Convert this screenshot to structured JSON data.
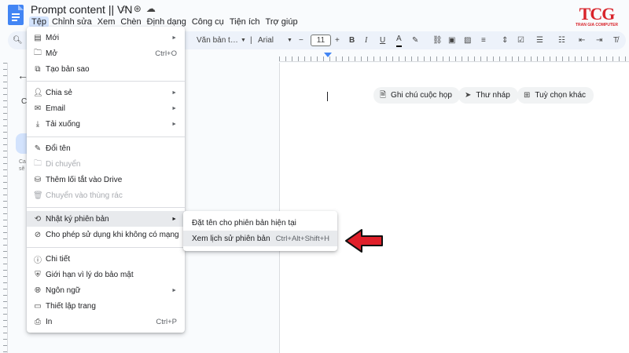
{
  "header": {
    "title": "Prompt content || VN",
    "menu": [
      "Tệp",
      "Chỉnh sửa",
      "Xem",
      "Chèn",
      "Định dạng",
      "Công cụ",
      "Tiện ích",
      "Trợ giúp"
    ]
  },
  "logo": {
    "text": "TCG",
    "subtitle": "TRAN GIA COMPUTER"
  },
  "toolbar": {
    "style": "Văn bản t…",
    "font": "Arial",
    "size": "11"
  },
  "outline": {
    "letter": "C",
    "note1": "Ca",
    "note2": "sẽ"
  },
  "chips": [
    "Ghi chú cuộc họp",
    "Thư nháp",
    "Tuỳ chọn khác"
  ],
  "file_menu": {
    "new": "Mới",
    "open": "Mở",
    "open_sc": "Ctrl+O",
    "copy": "Tạo bản sao",
    "share": "Chia sẻ",
    "email": "Email",
    "download": "Tải xuống",
    "rename": "Đổi tên",
    "move": "Di chuyển",
    "shortcut": "Thêm lối tắt vào Drive",
    "trash": "Chuyển vào thùng rác",
    "version": "Nhật ký phiên bản",
    "offline": "Cho phép sử dụng khi không có mạng",
    "details": "Chi tiết",
    "security": "Giới hạn vì lý do bảo mật",
    "language": "Ngôn ngữ",
    "page_setup": "Thiết lập trang",
    "print": "In",
    "print_sc": "Ctrl+P"
  },
  "sub_menu": {
    "name_version": "Đặt tên cho phiên bản hiện tại",
    "see_history": "Xem lịch sử phiên bản",
    "see_history_sc": "Ctrl+Alt+Shift+H"
  },
  "colors": {
    "accent": "#4285f4",
    "highlight": "#d3e3fd",
    "arrow": "#e0202a"
  }
}
